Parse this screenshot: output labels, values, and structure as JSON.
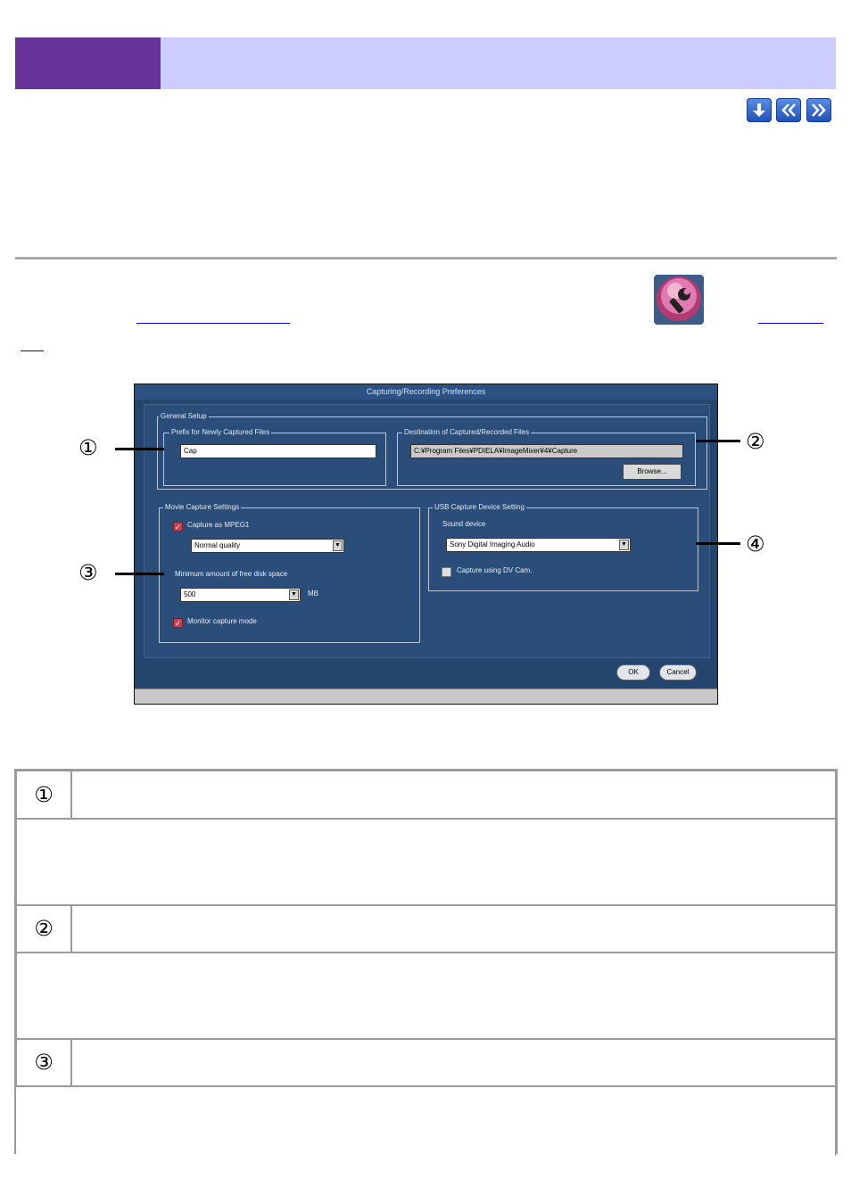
{
  "nav": {
    "down_icon": "arrow-down-icon",
    "prev_icon": "double-chevron-left-icon",
    "next_icon": "double-chevron-right-icon"
  },
  "dialog": {
    "title": "Capturing/Recording Preferences",
    "general_setup_label": "General Setup",
    "prefix_label": "Prefix for Newly Captured Files",
    "prefix_value": "Cap",
    "destination_label": "Destination of Captured/Recorded Files",
    "destination_value": "C:¥Program Files¥PDIELA¥ImageMixer¥4¥Capture",
    "browse_label": "Browse...",
    "movie_capture_label": "Movie Capture Settings",
    "capture_mpeg1_label": "Capture as MPEG1",
    "capture_mpeg1_checked": true,
    "quality_value": "Normal quality",
    "min_free_space_label": "Minimum amount of free disk space",
    "min_free_space_value": "500",
    "min_free_space_unit": "MB",
    "monitor_label": "Monitor capture mode",
    "monitor_checked": true,
    "usb_capture_label": "USB Capture Device Setting",
    "sound_device_label": "Sound device",
    "sound_device_value": "Sony Digital Imaging Audio",
    "dv_cam_label": "Capture using DV Cam.",
    "dv_cam_checked": false,
    "ok_label": "OK",
    "cancel_label": "Cancel"
  },
  "callouts": [
    "①",
    "②",
    "③",
    "④"
  ],
  "table": {
    "rows": [
      {
        "num": "①"
      },
      {
        "num": "②"
      },
      {
        "num": "③"
      }
    ]
  },
  "colors": {
    "header_dark": "#663399",
    "header_light": "#ccccff",
    "dialog_bg": "#24466e"
  }
}
